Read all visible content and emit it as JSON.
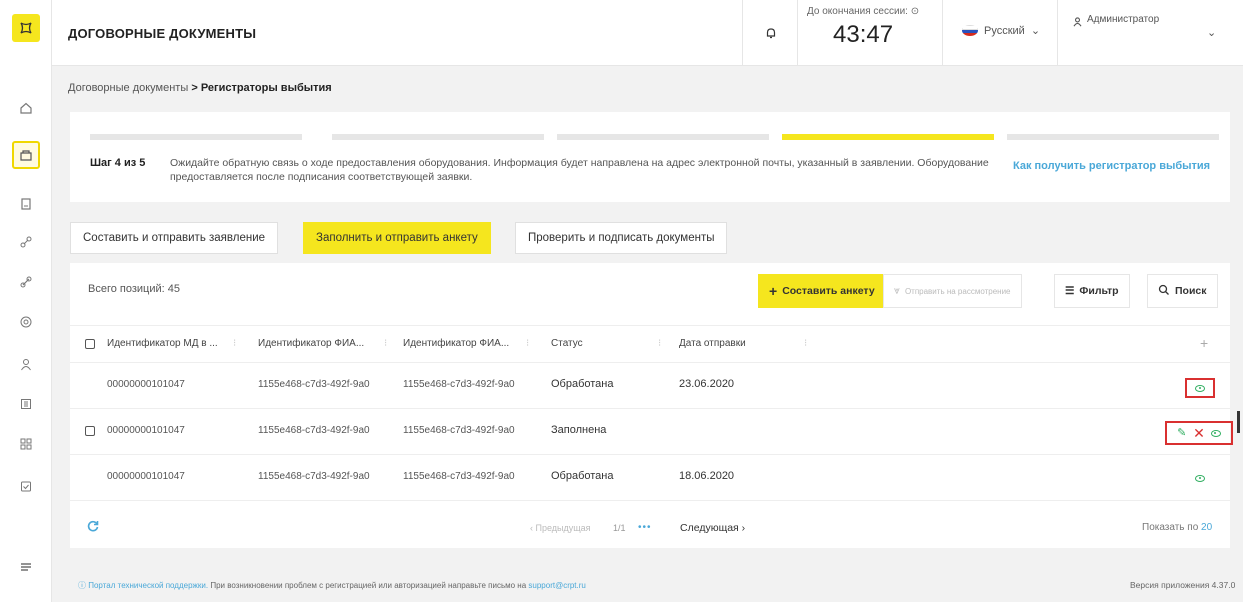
{
  "header": {
    "title": "ДОГОВОРНЫЕ ДОКУМЕНТЫ",
    "session_label": "До окончания сессии:",
    "session_time": "43:47",
    "language": "Русский",
    "user": "Администратор"
  },
  "breadcrumb": {
    "parent": "Договорные документы",
    "separator": ">",
    "current": "Регистраторы выбытия"
  },
  "steps": {
    "label": "Шаг 4 из 5",
    "text": "Ожидайте обратную связь о ходе предоставления оборудования. Информация будет направлена на адрес электронной почты, указанный в заявлении. Оборудование предоставляется после подписания соответствующей заявки.",
    "link": "Как получить регистратор выбытия",
    "total_steps": 5,
    "current_step": 4
  },
  "tabs": [
    {
      "label": "Составить и отправить заявление",
      "active": false
    },
    {
      "label": "Заполнить и отправить анкету",
      "active": true
    },
    {
      "label": "Проверить и подписать документы",
      "active": false
    }
  ],
  "toolbar": {
    "total": "Всего позиций: 45",
    "create_label": "Составить анкету",
    "submit_label": "Отправить на рассмотрение",
    "filter_label": "Фильтр",
    "search_label": "Поиск"
  },
  "table": {
    "columns": [
      "Идентификатор МД в ...",
      "Идентификатор ФИА...",
      "Идентификатор ФИА...",
      "Статус",
      "Дата отправки"
    ],
    "add_column": "+",
    "rows": [
      {
        "id_md": "00000000101047",
        "id_fia1": "1155e468-c7d3-492f-9a0",
        "id_fia2": "1155e468-c7d3-492f-9a0",
        "status": "Обработана",
        "date": "23.06.2020"
      },
      {
        "id_md": "00000000101047",
        "id_fia1": "1155e468-c7d3-492f-9a0",
        "id_fia2": "1155e468-c7d3-492f-9a0",
        "status": "Заполнена",
        "date": ""
      },
      {
        "id_md": "00000000101047",
        "id_fia1": "1155e468-c7d3-492f-9a0",
        "id_fia2": "1155e468-c7d3-492f-9a0",
        "status": "Обработана",
        "date": "18.06.2020"
      }
    ]
  },
  "pager": {
    "prev": "Предыдущая",
    "page": "1/1",
    "dots": "•••",
    "next": "Следующая",
    "show_label": "Показать по",
    "show_value": "20"
  },
  "footer": {
    "support_link": "Портал технической поддержки.",
    "support_text": "При возникновении проблем с регистрацией или авторизацией направьте письмо на",
    "support_email": "support@crpt.ru",
    "version": "Версия приложения 4.37.0"
  },
  "colors": {
    "accent": "#f5e61e",
    "link": "#4aa8d8",
    "ok": "#2fae60",
    "danger": "#d93030"
  }
}
